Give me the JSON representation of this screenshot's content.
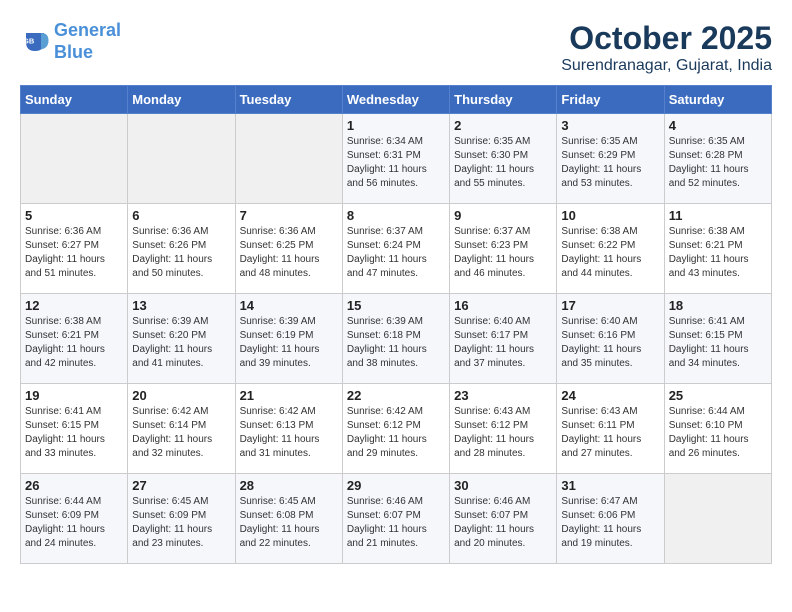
{
  "header": {
    "logo_line1": "General",
    "logo_line2": "Blue",
    "month": "October 2025",
    "location": "Surendranagar, Gujarat, India"
  },
  "weekdays": [
    "Sunday",
    "Monday",
    "Tuesday",
    "Wednesday",
    "Thursday",
    "Friday",
    "Saturday"
  ],
  "weeks": [
    [
      {
        "day": "",
        "info": ""
      },
      {
        "day": "",
        "info": ""
      },
      {
        "day": "",
        "info": ""
      },
      {
        "day": "1",
        "info": "Sunrise: 6:34 AM\nSunset: 6:31 PM\nDaylight: 11 hours and 56 minutes."
      },
      {
        "day": "2",
        "info": "Sunrise: 6:35 AM\nSunset: 6:30 PM\nDaylight: 11 hours and 55 minutes."
      },
      {
        "day": "3",
        "info": "Sunrise: 6:35 AM\nSunset: 6:29 PM\nDaylight: 11 hours and 53 minutes."
      },
      {
        "day": "4",
        "info": "Sunrise: 6:35 AM\nSunset: 6:28 PM\nDaylight: 11 hours and 52 minutes."
      }
    ],
    [
      {
        "day": "5",
        "info": "Sunrise: 6:36 AM\nSunset: 6:27 PM\nDaylight: 11 hours and 51 minutes."
      },
      {
        "day": "6",
        "info": "Sunrise: 6:36 AM\nSunset: 6:26 PM\nDaylight: 11 hours and 50 minutes."
      },
      {
        "day": "7",
        "info": "Sunrise: 6:36 AM\nSunset: 6:25 PM\nDaylight: 11 hours and 48 minutes."
      },
      {
        "day": "8",
        "info": "Sunrise: 6:37 AM\nSunset: 6:24 PM\nDaylight: 11 hours and 47 minutes."
      },
      {
        "day": "9",
        "info": "Sunrise: 6:37 AM\nSunset: 6:23 PM\nDaylight: 11 hours and 46 minutes."
      },
      {
        "day": "10",
        "info": "Sunrise: 6:38 AM\nSunset: 6:22 PM\nDaylight: 11 hours and 44 minutes."
      },
      {
        "day": "11",
        "info": "Sunrise: 6:38 AM\nSunset: 6:21 PM\nDaylight: 11 hours and 43 minutes."
      }
    ],
    [
      {
        "day": "12",
        "info": "Sunrise: 6:38 AM\nSunset: 6:21 PM\nDaylight: 11 hours and 42 minutes."
      },
      {
        "day": "13",
        "info": "Sunrise: 6:39 AM\nSunset: 6:20 PM\nDaylight: 11 hours and 41 minutes."
      },
      {
        "day": "14",
        "info": "Sunrise: 6:39 AM\nSunset: 6:19 PM\nDaylight: 11 hours and 39 minutes."
      },
      {
        "day": "15",
        "info": "Sunrise: 6:39 AM\nSunset: 6:18 PM\nDaylight: 11 hours and 38 minutes."
      },
      {
        "day": "16",
        "info": "Sunrise: 6:40 AM\nSunset: 6:17 PM\nDaylight: 11 hours and 37 minutes."
      },
      {
        "day": "17",
        "info": "Sunrise: 6:40 AM\nSunset: 6:16 PM\nDaylight: 11 hours and 35 minutes."
      },
      {
        "day": "18",
        "info": "Sunrise: 6:41 AM\nSunset: 6:15 PM\nDaylight: 11 hours and 34 minutes."
      }
    ],
    [
      {
        "day": "19",
        "info": "Sunrise: 6:41 AM\nSunset: 6:15 PM\nDaylight: 11 hours and 33 minutes."
      },
      {
        "day": "20",
        "info": "Sunrise: 6:42 AM\nSunset: 6:14 PM\nDaylight: 11 hours and 32 minutes."
      },
      {
        "day": "21",
        "info": "Sunrise: 6:42 AM\nSunset: 6:13 PM\nDaylight: 11 hours and 31 minutes."
      },
      {
        "day": "22",
        "info": "Sunrise: 6:42 AM\nSunset: 6:12 PM\nDaylight: 11 hours and 29 minutes."
      },
      {
        "day": "23",
        "info": "Sunrise: 6:43 AM\nSunset: 6:12 PM\nDaylight: 11 hours and 28 minutes."
      },
      {
        "day": "24",
        "info": "Sunrise: 6:43 AM\nSunset: 6:11 PM\nDaylight: 11 hours and 27 minutes."
      },
      {
        "day": "25",
        "info": "Sunrise: 6:44 AM\nSunset: 6:10 PM\nDaylight: 11 hours and 26 minutes."
      }
    ],
    [
      {
        "day": "26",
        "info": "Sunrise: 6:44 AM\nSunset: 6:09 PM\nDaylight: 11 hours and 24 minutes."
      },
      {
        "day": "27",
        "info": "Sunrise: 6:45 AM\nSunset: 6:09 PM\nDaylight: 11 hours and 23 minutes."
      },
      {
        "day": "28",
        "info": "Sunrise: 6:45 AM\nSunset: 6:08 PM\nDaylight: 11 hours and 22 minutes."
      },
      {
        "day": "29",
        "info": "Sunrise: 6:46 AM\nSunset: 6:07 PM\nDaylight: 11 hours and 21 minutes."
      },
      {
        "day": "30",
        "info": "Sunrise: 6:46 AM\nSunset: 6:07 PM\nDaylight: 11 hours and 20 minutes."
      },
      {
        "day": "31",
        "info": "Sunrise: 6:47 AM\nSunset: 6:06 PM\nDaylight: 11 hours and 19 minutes."
      },
      {
        "day": "",
        "info": ""
      }
    ]
  ]
}
